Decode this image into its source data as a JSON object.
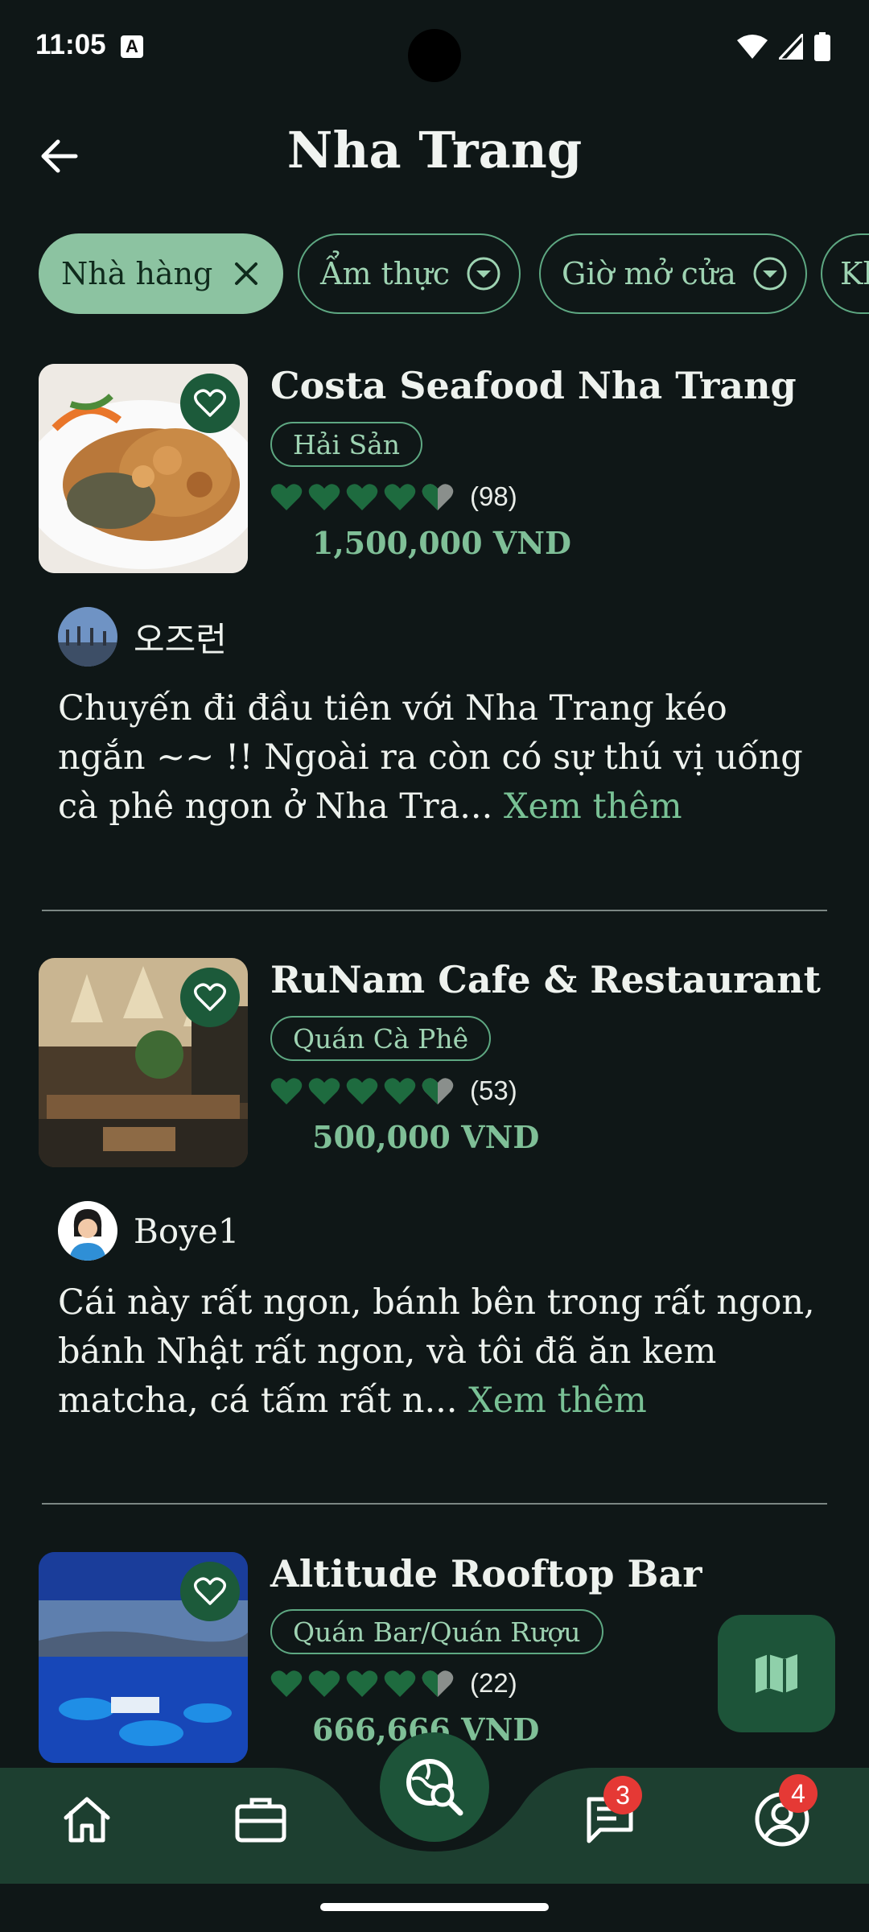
{
  "status_bar": {
    "time": "11:05",
    "indicator": "A"
  },
  "header": {
    "title": "Nha Trang",
    "back_icon": "arrow-left-icon"
  },
  "filters": [
    {
      "label": "Nhà hàng",
      "active": true,
      "icon": "close-icon"
    },
    {
      "label": "Ẩm thực",
      "active": false,
      "icon": "chevron-down-circle-icon"
    },
    {
      "label": "Giờ mở cửa",
      "active": false,
      "icon": "chevron-down-circle-icon"
    },
    {
      "label": "Kh",
      "active": false
    }
  ],
  "restaurants": [
    {
      "name": "Costa Seafood Nha Trang",
      "tag": "Hải Sản",
      "rating": 4.5,
      "review_count": "(98)",
      "price": "1,500,000 VND",
      "reviewer": "오즈런",
      "review_text": "Chuyến đi đầu tiên với Nha Trang kéo ngắn ~~ !! Ngoài ra còn có sự thú vị uống cà phê ngon ở Nha Tra...",
      "more_label": "Xem thêm"
    },
    {
      "name": "RuNam Cafe & Restaurant",
      "tag": "Quán Cà Phê",
      "rating": 4.5,
      "review_count": "(53)",
      "price": "500,000 VND",
      "reviewer": "Boye1",
      "review_text": "Cái này rất ngon, bánh bên trong rất ngon, bánh Nhật rất ngon, và tôi đã ăn kem matcha, cá tấm rất n...",
      "more_label": "Xem thêm"
    },
    {
      "name": "Altitude Rooftop Bar",
      "tag": "Quán Bar/Quán Rượu",
      "rating": 4.5,
      "review_count": "(22)",
      "price": "666,666 VND"
    }
  ],
  "bottom_nav": {
    "items": [
      "home-icon",
      "briefcase-icon",
      "search-map-icon",
      "chat-icon",
      "profile-icon"
    ],
    "chat_badge": "3",
    "profile_badge": "4"
  },
  "colors": {
    "background": "#0f1717",
    "accent": "#79c195",
    "nav": "#1d3f30",
    "badge": "#e53935"
  }
}
